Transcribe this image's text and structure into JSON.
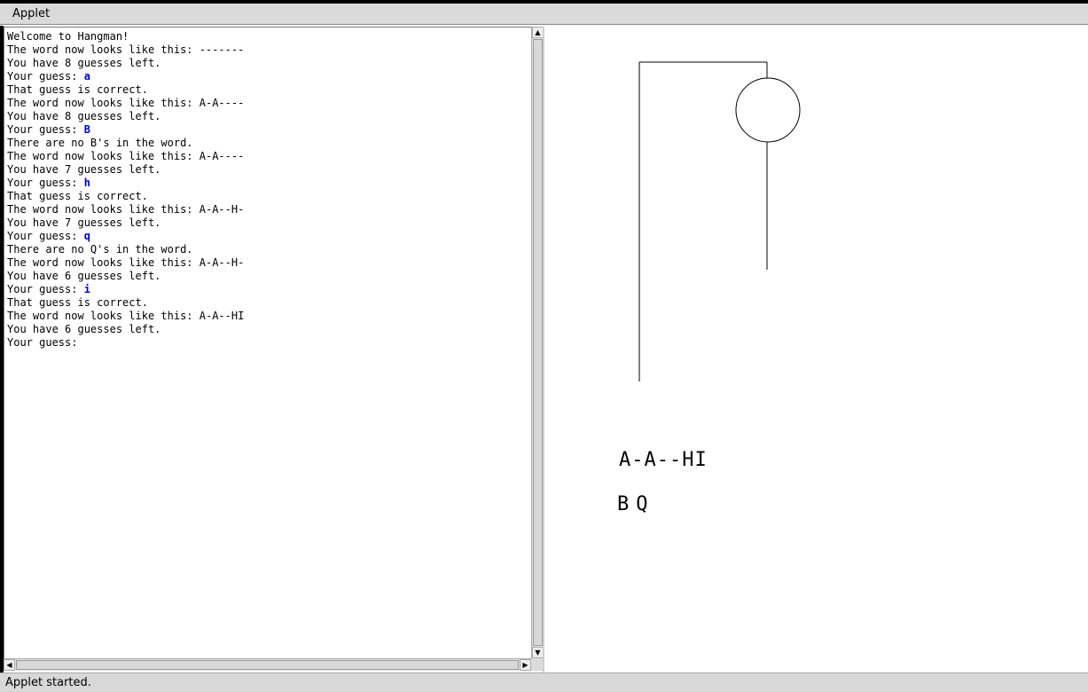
{
  "menubar": {
    "items": [
      "Applet"
    ]
  },
  "console": {
    "lines": [
      {
        "text": "Welcome to Hangman!",
        "guess": ""
      },
      {
        "text": "The word now looks like this: -------",
        "guess": ""
      },
      {
        "text": "You have 8 guesses left.",
        "guess": ""
      },
      {
        "text": "Your guess: ",
        "guess": "a"
      },
      {
        "text": "That guess is correct.",
        "guess": ""
      },
      {
        "text": "The word now looks like this: A-A----",
        "guess": ""
      },
      {
        "text": "You have 8 guesses left.",
        "guess": ""
      },
      {
        "text": "Your guess: ",
        "guess": "B"
      },
      {
        "text": "There are no B's in the word.",
        "guess": ""
      },
      {
        "text": "The word now looks like this: A-A----",
        "guess": ""
      },
      {
        "text": "You have 7 guesses left.",
        "guess": ""
      },
      {
        "text": "Your guess: ",
        "guess": "h"
      },
      {
        "text": "That guess is correct.",
        "guess": ""
      },
      {
        "text": "The word now looks like this: A-A--H-",
        "guess": ""
      },
      {
        "text": "You have 7 guesses left.",
        "guess": ""
      },
      {
        "text": "Your guess: ",
        "guess": "q"
      },
      {
        "text": "There are no Q's in the word.",
        "guess": ""
      },
      {
        "text": "The word now looks like this: A-A--H-",
        "guess": ""
      },
      {
        "text": "You have 6 guesses left.",
        "guess": ""
      },
      {
        "text": "Your guess: ",
        "guess": "i"
      },
      {
        "text": "That guess is correct.",
        "guess": ""
      },
      {
        "text": "The word now looks like this: A-A--HI",
        "guess": ""
      },
      {
        "text": "You have 6 guesses left.",
        "guess": ""
      },
      {
        "text": "Your guess:",
        "guess": ""
      }
    ],
    "guess_color": "#0000cc"
  },
  "scrollbars": {
    "up_icon": "triangle-up",
    "down_icon": "triangle-down",
    "left_icon": "triangle-left",
    "right_icon": "triangle-right"
  },
  "canvas": {
    "word": "A-A--HI",
    "incorrect": "BQ"
  },
  "status": {
    "text": "Applet started."
  }
}
